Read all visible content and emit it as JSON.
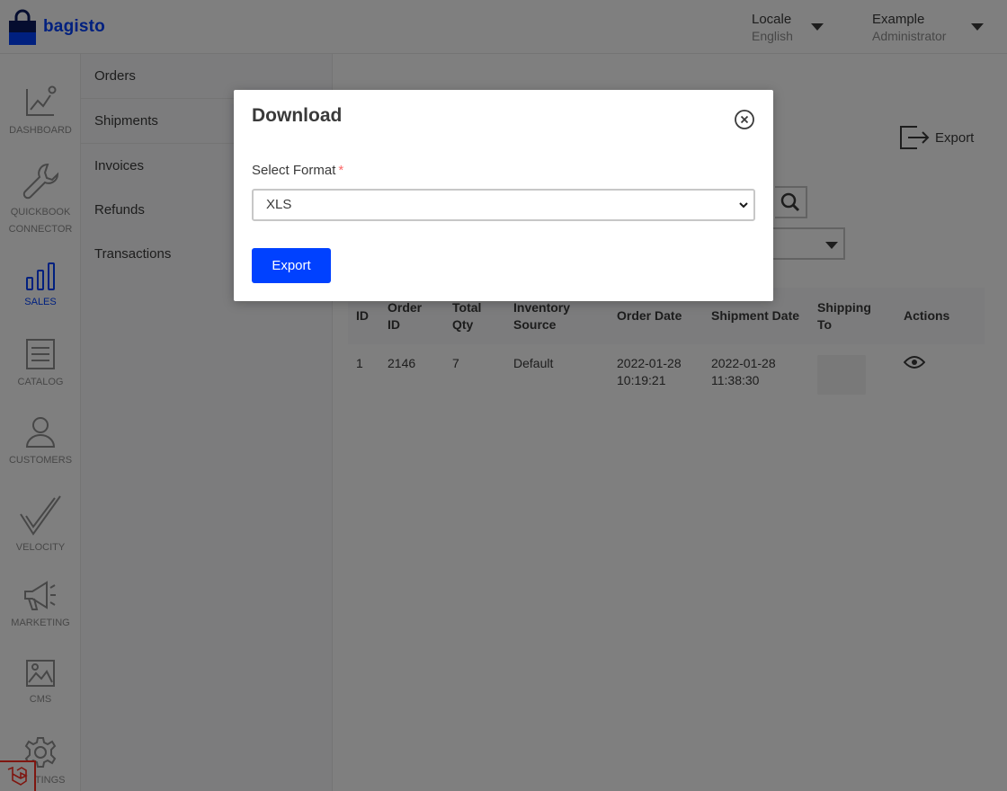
{
  "header": {
    "brand": "bagisto",
    "locale_label": "Locale",
    "locale_value": "English",
    "user_name": "Example",
    "user_role": "Administrator"
  },
  "leftnav": {
    "items": [
      {
        "label": "Dashboard",
        "icon": "dashboard-icon"
      },
      {
        "label": "QuickBook Connector",
        "icon": "wrench-icon"
      },
      {
        "label": "Sales",
        "icon": "sales-bar-chart-icon",
        "active": true
      },
      {
        "label": "Catalog",
        "icon": "catalog-list-icon"
      },
      {
        "label": "Customers",
        "icon": "user-icon"
      },
      {
        "label": "Velocity",
        "icon": "velocity-check-icon"
      },
      {
        "label": "Marketing",
        "icon": "megaphone-icon"
      },
      {
        "label": "CMS",
        "icon": "cms-image-icon"
      },
      {
        "label": "Settings",
        "icon": "gear-icon"
      }
    ]
  },
  "subnav": {
    "items": [
      "Orders",
      "Shipments",
      "Invoices",
      "Refunds",
      "Transactions"
    ]
  },
  "content": {
    "export_label": "Export",
    "table": {
      "headers": [
        "ID",
        "Order ID",
        "Total Qty",
        "Inventory Source",
        "Order Date",
        "Shipment Date",
        "Shipping To",
        "Actions"
      ],
      "rows": [
        {
          "id": "1",
          "order_id": "2146",
          "total_qty": "7",
          "inventory_source": "Default",
          "order_date": "2022-01-28 10:19:21",
          "shipment_date": "2022-01-28 11:38:30",
          "shipping_to": ""
        }
      ]
    }
  },
  "modal": {
    "title": "Download",
    "field_label": "Select Format",
    "required_mark": "*",
    "selected_format": "XLS",
    "submit_label": "Export"
  },
  "colors": {
    "accent": "#0041ff",
    "required": "#fc6868",
    "overlay": "rgba(0,0,0,0.5)"
  }
}
